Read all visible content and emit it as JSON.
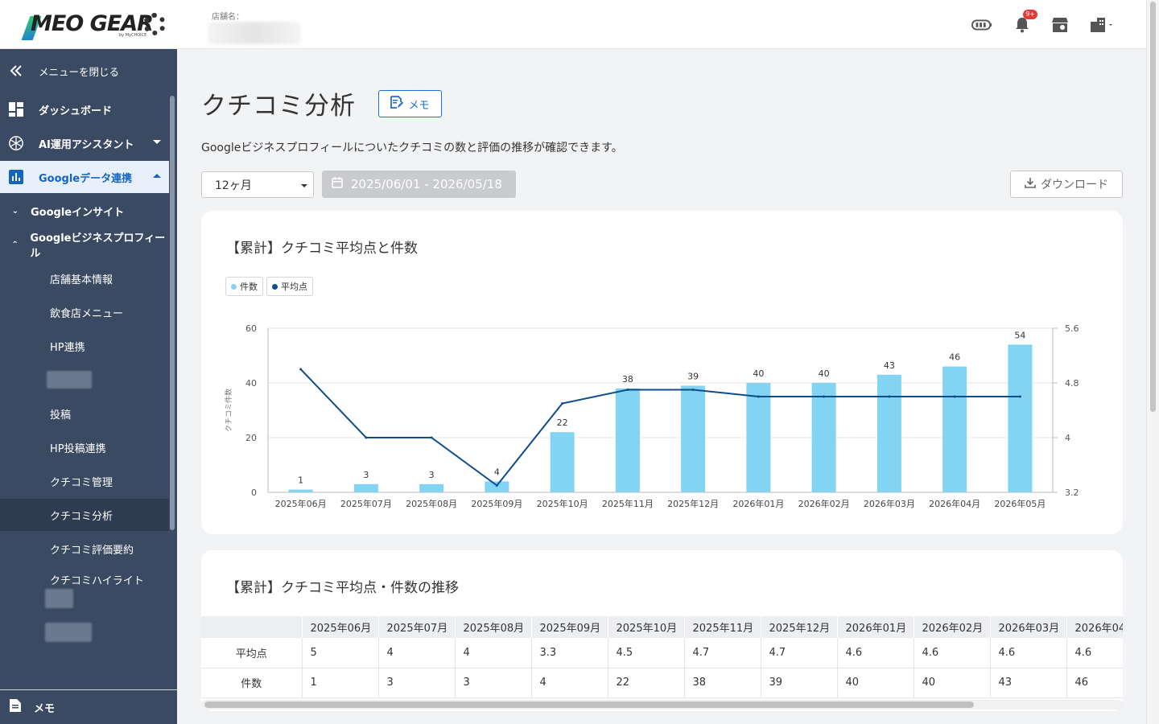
{
  "header": {
    "logo_text": "MEO GEAR",
    "logo_sub": "by MyCHOICE",
    "store_label": "店舗名：",
    "notification_badge": "9+"
  },
  "sidebar": {
    "close_menu": "メニューを閉じる",
    "dashboard": "ダッシュボード",
    "ai_assistant": "AI運用アシスタント",
    "google_data": "Googleデータ連携",
    "google_insight": "Googleインサイト",
    "gbp": "Googleビジネスプロフィール",
    "leaves": [
      "店舗基本情報",
      "飲食店メニュー",
      "HP連携",
      "投稿",
      "HP投稿連携",
      "クチコミ管理",
      "クチコミ分析",
      "クチコミ評価要約",
      "クチコミハイライト"
    ],
    "memo": "メモ"
  },
  "main": {
    "title": "クチコミ分析",
    "memo_button": "メモ",
    "description": "Googleビジネスプロフィールについたクチコミの数と評価の推移が確認できます。",
    "period": "12ヶ月",
    "date_range": "2025/06/01 - 2026/05/18",
    "download": "ダウンロード",
    "chart_card_title": "【累計】クチコミ平均点と件数",
    "table_card_title": "【累計】クチコミ平均点・件数の推移",
    "table_row_avg": "平均点",
    "table_row_count": "件数"
  },
  "colors": {
    "bar": "#82d4f2",
    "line": "#0f4c8a",
    "accent": "#1e6ed6",
    "sidebar_bg": "#3a4a63"
  },
  "chart_data": {
    "type": "bar",
    "categories": [
      "2025年06月",
      "2025年07月",
      "2025年08月",
      "2025年09月",
      "2025年10月",
      "2025年11月",
      "2025年12月",
      "2026年01月",
      "2026年02月",
      "2026年03月",
      "2026年04月",
      "2026年05月"
    ],
    "series": [
      {
        "name": "件数",
        "type": "bar",
        "axis": "left",
        "values": [
          1,
          3,
          3,
          4,
          22,
          38,
          39,
          40,
          40,
          43,
          46,
          54
        ]
      },
      {
        "name": "平均点",
        "type": "line",
        "axis": "right",
        "values": [
          5,
          4,
          4,
          3.3,
          4.5,
          4.7,
          4.7,
          4.6,
          4.6,
          4.6,
          4.6,
          4.6
        ]
      }
    ],
    "ylabel": "クチコミ件数",
    "ylim": [
      0,
      60
    ],
    "yticks": [
      0,
      20,
      40,
      60
    ],
    "y2lim": [
      3.2,
      5.6
    ],
    "y2ticks": [
      3.2,
      4,
      4.8,
      5.6
    ],
    "grid": true,
    "legend": "top-left"
  }
}
